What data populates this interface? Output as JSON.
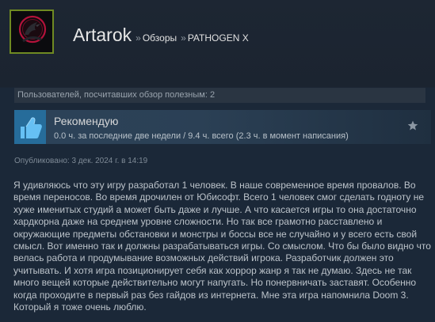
{
  "header": {
    "user_name": "Artarok",
    "separator": "»",
    "breadcrumb": [
      "Обзоры",
      "PATHOGEN X"
    ]
  },
  "helpful": {
    "text": "Пользователей, посчитавших обзор полезным: 2"
  },
  "recommendation": {
    "label": "Рекомендую",
    "hours": "0.0 ч. за последние две недели / 9.4 ч. всего (2.3 ч. в момент написания)"
  },
  "published": "Опубликовано: 3 дек. 2024 г. в 14:19",
  "review": {
    "text": "Я удивляюсь что эту игру разработал 1 человек. В наше современное время провалов. Во время переносов. Во время дрочилен от Юбисофт. Всего 1 человек смог сделать годноту не хуже именитых студий а может быть даже и лучше. А что касается игры то она достаточно хардкорна даже на среднем уровне сложности. Но так все грамотно расставлено и окружающие предметы обстановки и монстры и боссы все не случайно и у всего есть свой смысл. Вот именно так и должны разрабатываться игры. Со смыслом. Что бы было видно что велась работа и продумывание возможных действий игрока. Разработчик должен это учитывать. И хотя игра позиционирует себя как хоррор жанр я так не думаю. Здесь не так много вещей которые действительно могут напугать. Но понервничать заставят. Особенно когда проходите в первый раз без гайдов из интернета. Мне эта игра напомнила Doom 3. Который я тоже очень люблю."
  },
  "icons": {
    "avatar": "red-bird-avatar",
    "thumb": "thumbs-up-icon",
    "award": "star-icon"
  },
  "colors": {
    "background": "#1b2838",
    "avatar_border": "#6f8a22",
    "thumb_blue": "#66c0f4",
    "recommend_panel": "#2c4359"
  }
}
